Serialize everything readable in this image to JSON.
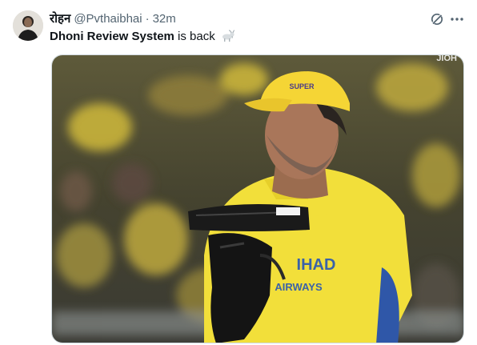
{
  "user": {
    "display_name": "रोहन",
    "handle": "@Pvthaibhai",
    "separator": "·",
    "time": "32m"
  },
  "tweet": {
    "bold_text": "Dhoni Review System",
    "text": " is back",
    "emoji_icon": "goat-icon"
  },
  "actions": {
    "grok_icon": "grok-icon",
    "more_icon": "more-icon"
  },
  "media": {
    "watermark": "JIOH",
    "jersey_text_top": "IHAD",
    "jersey_text_bottom": "AIRWAYS",
    "helmet_text": "SUPER"
  },
  "colors": {
    "jersey_yellow": "#f2df3a",
    "stand_yellow": "#c9b43a",
    "glove_black": "#1a1a1a",
    "link_gray": "#536471"
  }
}
